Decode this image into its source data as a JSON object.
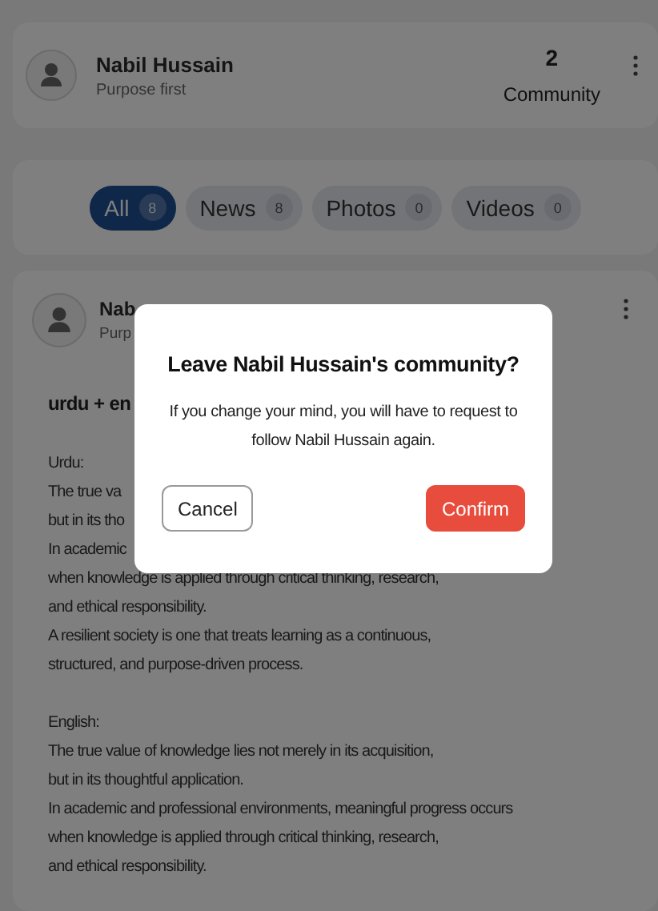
{
  "profile": {
    "name": "Nabil Hussain",
    "tagline": "Purpose first",
    "count": "2",
    "count_label": "Community"
  },
  "tabs": [
    {
      "label": "All",
      "count": "8",
      "selected": true
    },
    {
      "label": "News",
      "count": "8",
      "selected": false
    },
    {
      "label": "Photos",
      "count": "0",
      "selected": false
    },
    {
      "label": "Videos",
      "count": "0",
      "selected": false
    }
  ],
  "post": {
    "author": "Nab",
    "tagline": "Purp",
    "title": "urdu + en",
    "sections": [
      [
        "Urdu:",
        "The true va",
        "but in its tho",
        "In academic",
        "when knowledge is applied through critical thinking, research,",
        "and ethical responsibility.",
        "A resilient society is one that treats learning as a continuous,",
        "structured, and purpose-driven process."
      ],
      [
        "English:",
        "The true value of knowledge lies not merely in its acquisition,",
        "but in its thoughtful application.",
        "In academic and professional environments, meaningful progress occurs",
        "when knowledge is applied through critical thinking, research,",
        "and ethical responsibility."
      ]
    ]
  },
  "dialog": {
    "title": "Leave Nabil Hussain's community?",
    "message": "If you change your mind, you will have to request to follow Nabil Hussain again.",
    "buttons": [
      {
        "label": "Cancel",
        "kind": "secondary"
      },
      {
        "label": "Confirm",
        "kind": "danger"
      }
    ]
  }
}
